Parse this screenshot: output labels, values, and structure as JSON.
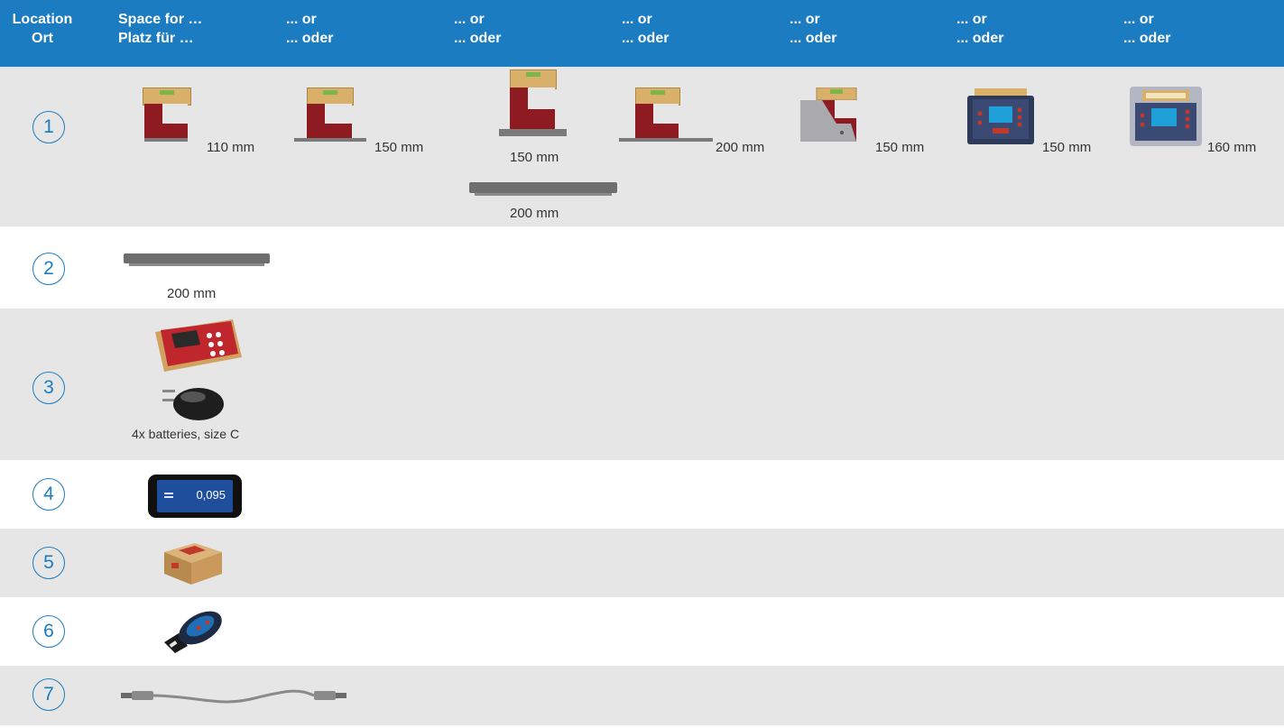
{
  "header": {
    "col0": [
      "Location",
      "Ort"
    ],
    "col1": [
      "Space for …",
      "Platz für …"
    ],
    "col2": [
      "... or",
      "... oder"
    ],
    "col3": [
      "... or",
      "... oder"
    ],
    "col4": [
      "... or",
      "... oder"
    ],
    "col5": [
      "... or",
      "... oder"
    ],
    "col6": [
      "... or",
      "... oder"
    ],
    "col7": [
      "... or",
      "... oder"
    ]
  },
  "rows": [
    {
      "num": "1",
      "labels": [
        "110 mm",
        "150 mm",
        "150 mm",
        "200 mm",
        "200 mm",
        "150 mm",
        "150 mm",
        "160 mm"
      ]
    },
    {
      "num": "2",
      "labels": [
        "200 mm"
      ]
    },
    {
      "num": "3",
      "labels": [
        "4x batteries, size C"
      ]
    },
    {
      "num": "4",
      "labels": [],
      "display_value": "0,095"
    },
    {
      "num": "5",
      "labels": []
    },
    {
      "num": "6",
      "labels": []
    },
    {
      "num": "7",
      "labels": []
    }
  ],
  "colors": {
    "header": "#1b7cc1",
    "row_shade": "#e6e6e6",
    "circle": "#1b7cc1"
  },
  "images": [
    "level-red-110",
    "level-red-150",
    "level-red-150-with-bar",
    "level-red-200",
    "level-prism-150",
    "electronic-level-150",
    "electronic-level-160",
    "base-bar-200",
    "electronic-unit-red",
    "usb-charger",
    "tablet-display",
    "small-box-sensor",
    "wireless-key-fob",
    "connection-cable"
  ]
}
